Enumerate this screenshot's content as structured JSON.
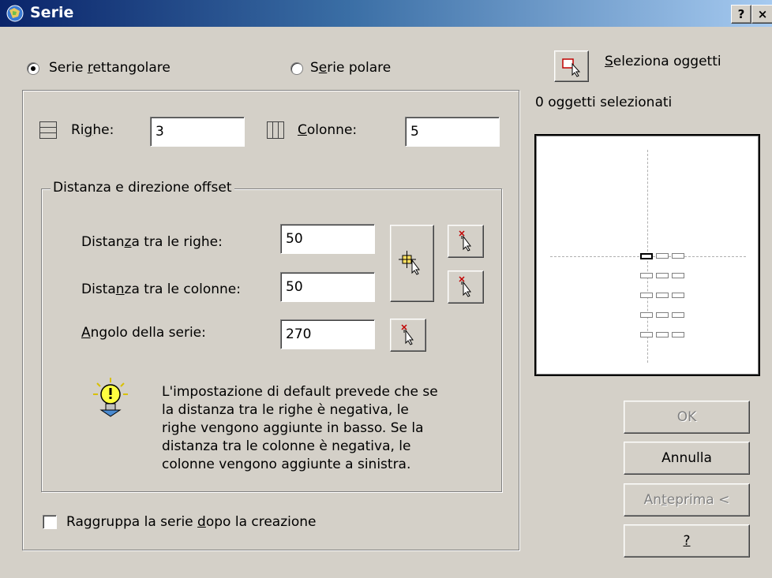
{
  "window": {
    "title": "Serie",
    "help_btn": "?",
    "close_btn": "×"
  },
  "options": {
    "rect_pre": "Serie ",
    "rect_key": "r",
    "rect_post": "ettangolare",
    "rect_selected": true,
    "polar_pre": "S",
    "polar_key": "e",
    "polar_post": "rie polare",
    "polar_selected": false
  },
  "select": {
    "key": "S",
    "rest": "eleziona oggetti",
    "count_text": "0 oggetti selezionati"
  },
  "rows": {
    "pre": "Ri",
    "key": "g",
    "post": "he:",
    "value": "3"
  },
  "cols": {
    "pre": "",
    "key": "C",
    "post": "olonne:",
    "value": "5"
  },
  "offset_group": {
    "legend": "Distanza e direzione offset",
    "row_dist_pre": "Distan",
    "row_dist_key": "z",
    "row_dist_post": "a tra le righe:",
    "row_dist_value": "50",
    "col_dist_pre": "Dista",
    "col_dist_key": "n",
    "col_dist_post": "za tra le colonne:",
    "col_dist_value": "50",
    "angle_pre": "",
    "angle_key": "A",
    "angle_post": "ngolo della serie:",
    "angle_value": "270"
  },
  "tip": {
    "line1": "L'impostazione di default prevede che se",
    "line2": "la distanza tra le righe è negativa, le",
    "line3": "righe vengono aggiunte in basso. Se la",
    "line4": "distanza tra le colonne è negativa, le",
    "line5": "colonne vengono aggiunte a sinistra."
  },
  "group_check": {
    "pre": "Raggruppa la serie ",
    "key": "d",
    "post": "opo la creazione",
    "checked": false
  },
  "buttons": {
    "ok": "OK",
    "cancel": "Annulla",
    "preview_pre": "An",
    "preview_key": "t",
    "preview_post": "eprima <",
    "help": "?"
  },
  "colors": {
    "dialog_bg": "#d4d0c8",
    "title_start": "#0a246a",
    "title_end": "#a6caf0",
    "pick_red": "#c00000"
  }
}
